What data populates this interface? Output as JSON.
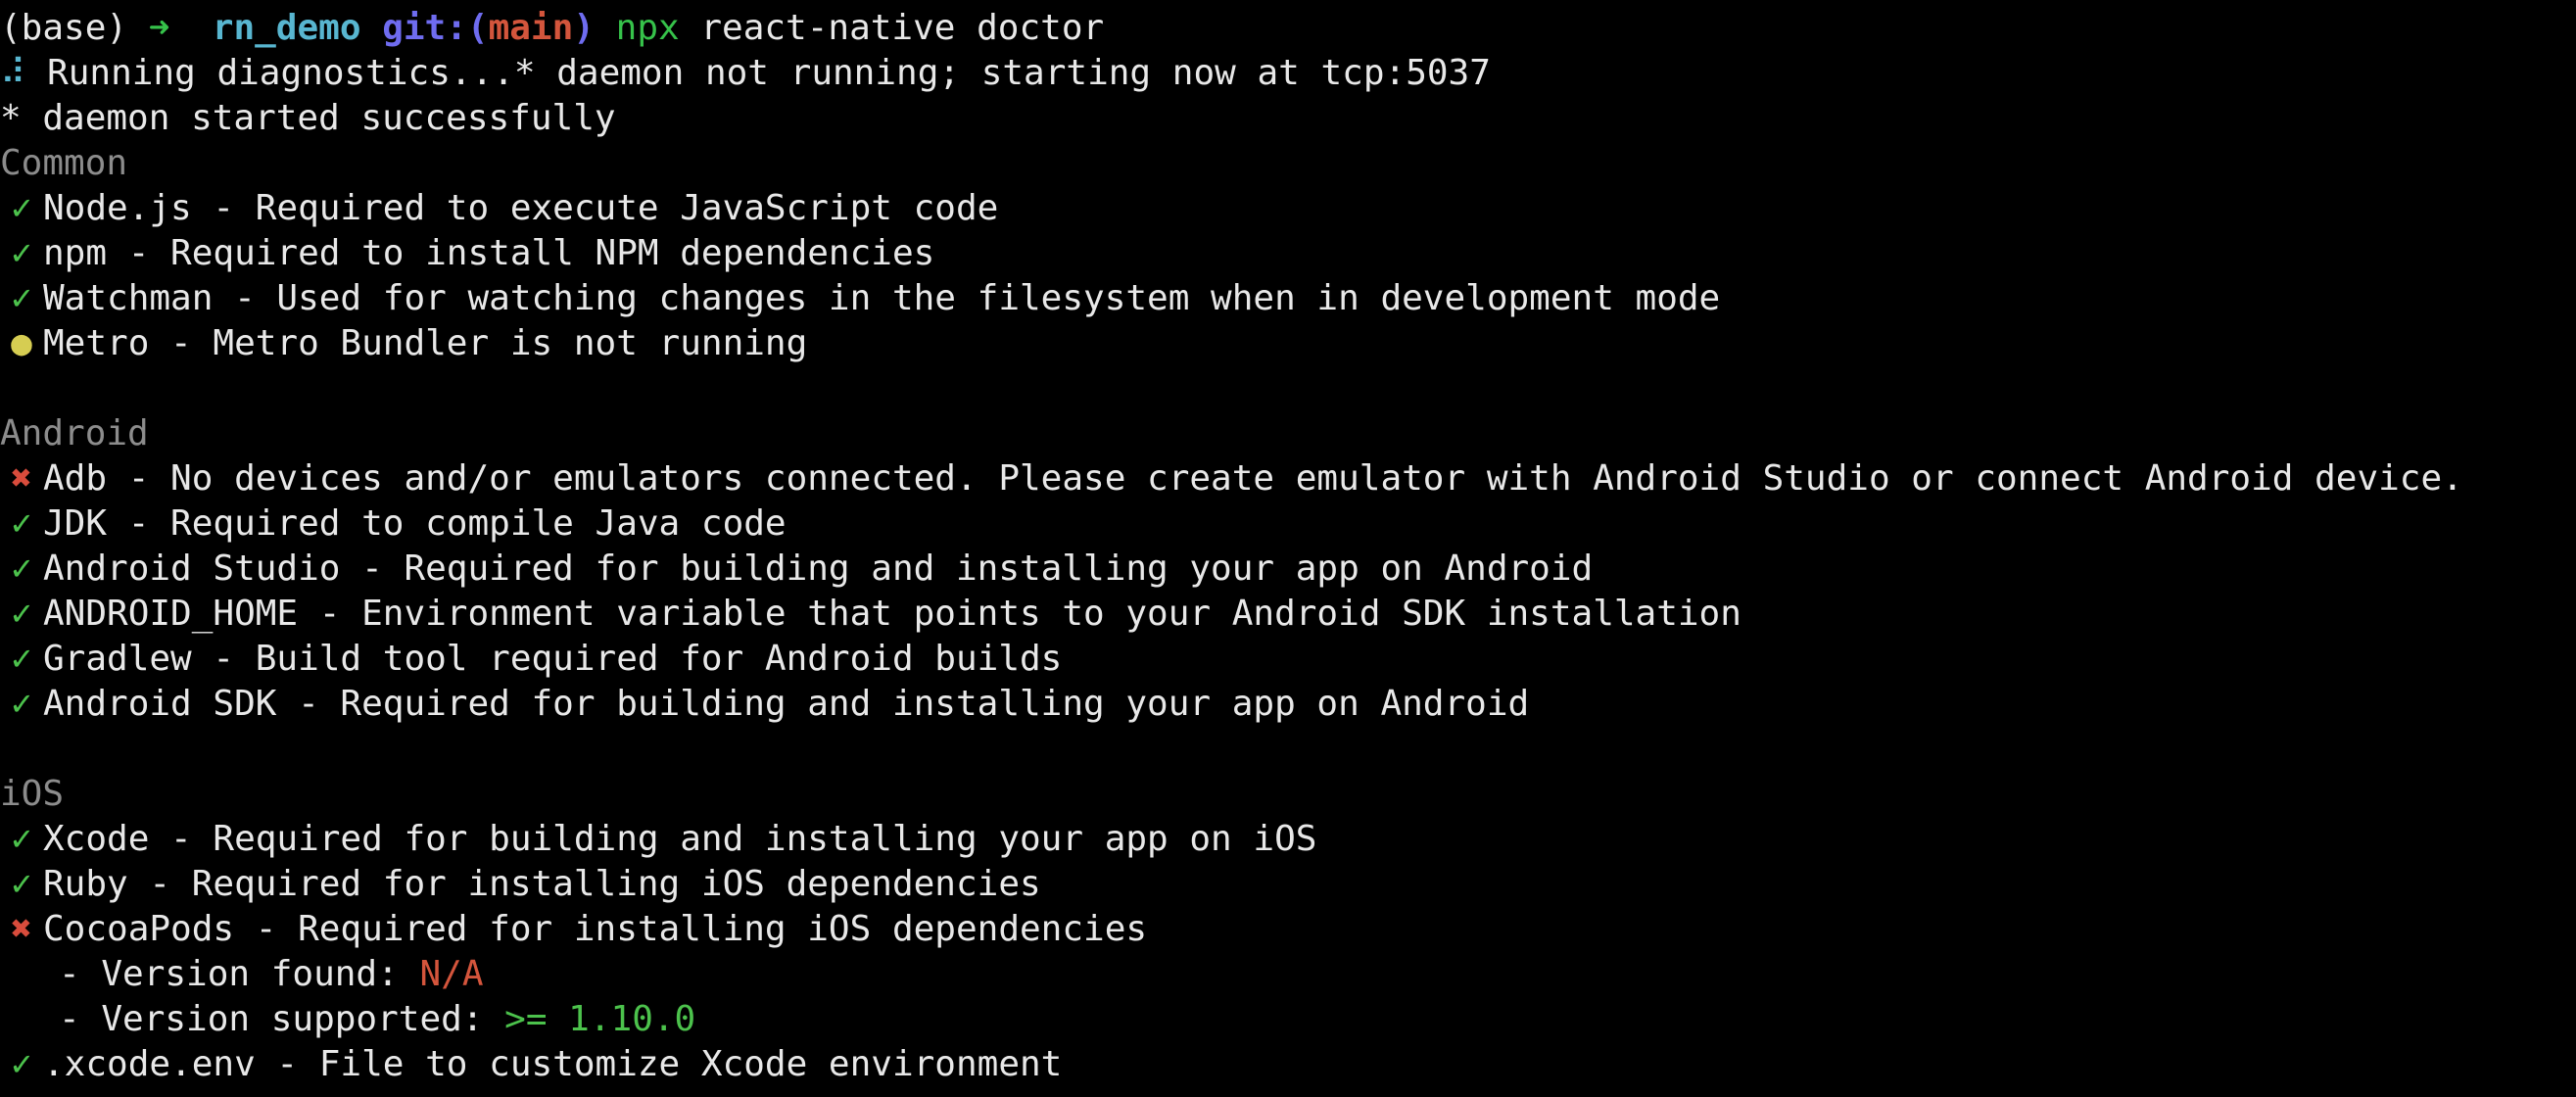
{
  "prompt": {
    "env": "(base)",
    "arrow": "➜",
    "dir": "rn_demo",
    "git_label": "git:(",
    "branch": "main",
    "git_close": ")",
    "cmd_npx": "npx",
    "cmd_rest": "react-native doctor"
  },
  "output": {
    "spinner": "⠼",
    "running": "Running diagnostics...* daemon not running; starting now at tcp:5037",
    "daemon_started": "* daemon started successfully"
  },
  "icons": {
    "check": "✓",
    "cross": "✖",
    "warn": "●"
  },
  "colors": {
    "background": "#000000",
    "text": "#e8e8e8",
    "success": "#4cc24c",
    "error": "#d84c3c",
    "warning": "#d6cd52",
    "section": "#8c8c8c",
    "directory": "#58b6d0",
    "git": "#6f6cf0",
    "branch": "#d4553c"
  },
  "sections": {
    "common": {
      "title": "Common",
      "items": [
        {
          "status": "check",
          "text": "Node.js - Required to execute JavaScript code"
        },
        {
          "status": "check",
          "text": "npm - Required to install NPM dependencies"
        },
        {
          "status": "check",
          "text": "Watchman - Used for watching changes in the filesystem when in development mode"
        },
        {
          "status": "warn",
          "text": "Metro - Metro Bundler is not running"
        }
      ]
    },
    "android": {
      "title": "Android",
      "items": [
        {
          "status": "cross",
          "text": "Adb - No devices and/or emulators connected. Please create emulator with Android Studio or connect Android device."
        },
        {
          "status": "check",
          "text": "JDK - Required to compile Java code"
        },
        {
          "status": "check",
          "text": "Android Studio - Required for building and installing your app on Android"
        },
        {
          "status": "check",
          "text": "ANDROID_HOME - Environment variable that points to your Android SDK installation"
        },
        {
          "status": "check",
          "text": "Gradlew - Build tool required for Android builds"
        },
        {
          "status": "check",
          "text": "Android SDK - Required for building and installing your app on Android"
        }
      ]
    },
    "ios": {
      "title": "iOS",
      "items": [
        {
          "status": "check",
          "text": "Xcode - Required for building and installing your app on iOS"
        },
        {
          "status": "check",
          "text": "Ruby - Required for installing iOS dependencies"
        },
        {
          "status": "cross",
          "text": "CocoaPods - Required for installing iOS dependencies"
        }
      ],
      "cocoapods_details": {
        "found_label": "- Version found: ",
        "found_value": "N/A",
        "supported_label": "- Version supported: ",
        "supported_value": ">= 1.10.0"
      },
      "xcode_env": {
        "status": "check",
        "text": ".xcode.env - File to customize Xcode environment"
      }
    }
  }
}
